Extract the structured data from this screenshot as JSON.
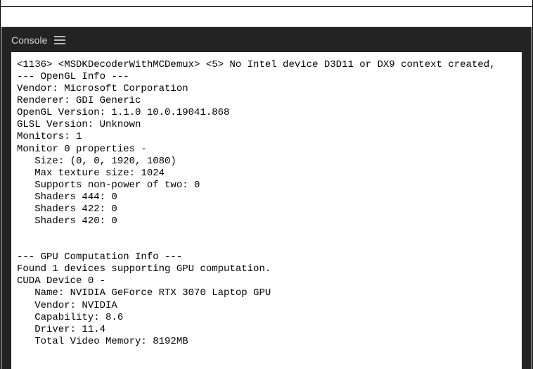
{
  "header": {
    "title": "Console"
  },
  "console": {
    "lines": [
      "<1136> <MSDKDecoderWithMCDemux> <5> No Intel device D3D11 or DX9 context created,",
      "--- OpenGL Info ---",
      "Vendor: Microsoft Corporation",
      "Renderer: GDI Generic",
      "OpenGL Version: 1.1.0 10.0.19041.868",
      "GLSL Version: Unknown",
      "Monitors: 1",
      "Monitor 0 properties -",
      "   Size: (0, 0, 1920, 1080)",
      "   Max texture size: 1024",
      "   Supports non-power of two: 0",
      "   Shaders 444: 0",
      "   Shaders 422: 0",
      "   Shaders 420: 0",
      "",
      "",
      "--- GPU Computation Info ---",
      "Found 1 devices supporting GPU computation.",
      "CUDA Device 0 -",
      "   Name: NVIDIA GeForce RTX 3070 Laptop GPU",
      "   Vendor: NVIDIA",
      "   Capability: 8.6",
      "   Driver: 11.4",
      "   Total Video Memory: 8192MB"
    ]
  }
}
